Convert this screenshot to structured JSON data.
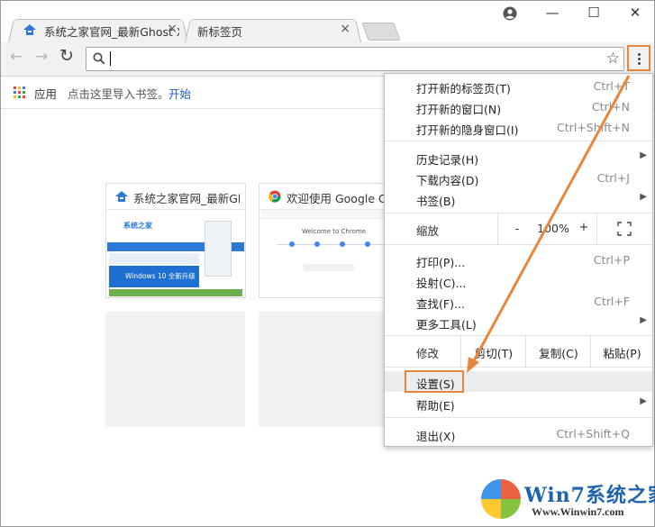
{
  "tabs": [
    {
      "title": "系统之家官网_最新Ghost XP",
      "active": false
    },
    {
      "title": "新标签页",
      "active": true
    }
  ],
  "tab_close_glyph": "×",
  "window_controls": {
    "account_icon": "account-icon",
    "minimize": "—",
    "maximize": "☐",
    "close": "✕"
  },
  "toolbar": {
    "address_value": "",
    "back_icon": "back-arrow-icon",
    "forward_icon": "forward-arrow-icon",
    "reload_icon": "reload-icon",
    "bookmark_star_icon": "star-icon"
  },
  "bookmarks_bar": {
    "apps_label": "应用",
    "import_text": "点击这里导入书签。",
    "start_link": "开始"
  },
  "thumbnails": [
    {
      "title": "系统之家官网_最新Ghost XP",
      "preview_text": "系统之家",
      "preview_banner": "Windows 10 全新升级"
    },
    {
      "title": "欢迎使用 Google Chrome",
      "preview_text": "Welcome to Chrome"
    }
  ],
  "menu": {
    "group1": [
      {
        "label": "打开新的标签页(T)",
        "shortcut": "Ctrl+T"
      },
      {
        "label": "打开新的窗口(N)",
        "shortcut": "Ctrl+N"
      },
      {
        "label": "打开新的隐身窗口(I)",
        "shortcut": "Ctrl+Shift+N"
      }
    ],
    "group2": [
      {
        "label": "历史记录(H)",
        "shortcut": "",
        "submenu": true
      },
      {
        "label": "下载内容(D)",
        "shortcut": "Ctrl+J",
        "submenu": false
      },
      {
        "label": "书签(B)",
        "shortcut": "",
        "submenu": true
      }
    ],
    "zoom": {
      "label": "缩放",
      "minus": "-",
      "value": "100%",
      "plus": "+",
      "fullscreen_icon": "fullscreen-icon"
    },
    "group3": [
      {
        "label": "打印(P)...",
        "shortcut": "Ctrl+P",
        "submenu": false
      },
      {
        "label": "投射(C)...",
        "shortcut": "",
        "submenu": false
      },
      {
        "label": "查找(F)...",
        "shortcut": "Ctrl+F",
        "submenu": false
      },
      {
        "label": "更多工具(L)",
        "shortcut": "",
        "submenu": true
      }
    ],
    "edit": {
      "label": "修改",
      "cut": "剪切(T)",
      "copy": "复制(C)",
      "paste": "粘贴(P)"
    },
    "group4": [
      {
        "label": "设置(S)",
        "shortcut": "",
        "submenu": false,
        "highlighted": true
      },
      {
        "label": "帮助(E)",
        "shortcut": "",
        "submenu": true
      }
    ],
    "exit": {
      "label": "退出(X)",
      "shortcut": "Ctrl+Shift+Q"
    }
  },
  "colors": {
    "annotation": "#e8863a",
    "link": "#1a5ec9"
  },
  "watermark": {
    "brand": "Win7系统之家",
    "url": "Www.Winwin7.com"
  }
}
